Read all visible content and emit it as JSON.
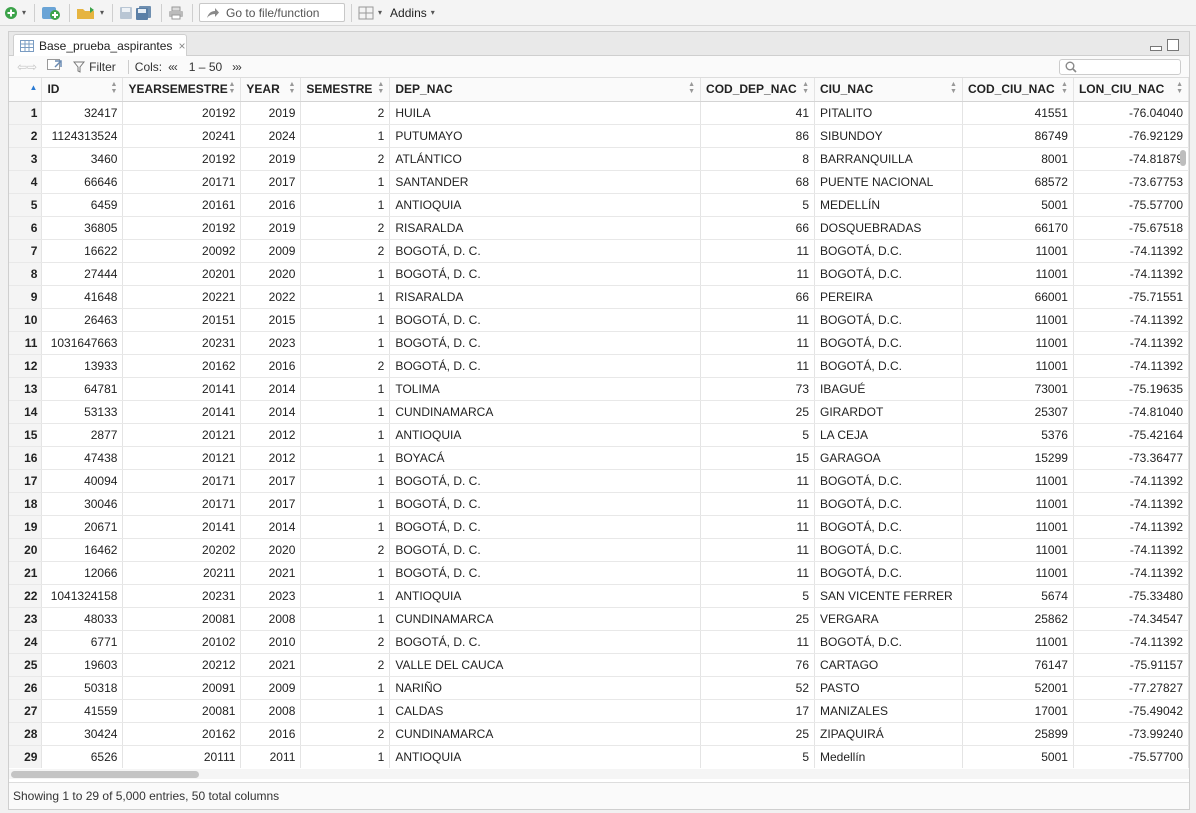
{
  "toolbar": {
    "goto_placeholder": "Go to file/function",
    "addins_label": "Addins"
  },
  "tab": {
    "title": "Base_prueba_aspirantes",
    "close": "×"
  },
  "viewer": {
    "filter_label": "Filter",
    "cols_label": "Cols:",
    "col_prev": "«‹",
    "col_range": "1 – 50",
    "col_next": "›»"
  },
  "table": {
    "columns": [
      "ID",
      "YEARSEMESTRE",
      "YEAR",
      "SEMESTRE",
      "DEP_NAC",
      "COD_DEP_NAC",
      "CIU_NAC",
      "COD_CIU_NAC",
      "LON_CIU_NAC"
    ],
    "rows": [
      [
        "1",
        "32417",
        "20192",
        "2019",
        "2",
        "HUILA",
        "41",
        "PITALITO",
        "41551",
        "-76.04040"
      ],
      [
        "2",
        "1124313524",
        "20241",
        "2024",
        "1",
        "PUTUMAYO",
        "86",
        "SIBUNDOY",
        "86749",
        "-76.92129"
      ],
      [
        "3",
        "3460",
        "20192",
        "2019",
        "2",
        "ATLÁNTICO",
        "8",
        "BARRANQUILLA",
        "8001",
        "-74.81879"
      ],
      [
        "4",
        "66646",
        "20171",
        "2017",
        "1",
        "SANTANDER",
        "68",
        "PUENTE NACIONAL",
        "68572",
        "-73.67753"
      ],
      [
        "5",
        "6459",
        "20161",
        "2016",
        "1",
        "ANTIOQUIA",
        "5",
        "MEDELLÍN",
        "5001",
        "-75.57700"
      ],
      [
        "6",
        "36805",
        "20192",
        "2019",
        "2",
        "RISARALDA",
        "66",
        "DOSQUEBRADAS",
        "66170",
        "-75.67518"
      ],
      [
        "7",
        "16622",
        "20092",
        "2009",
        "2",
        "BOGOTÁ, D. C.",
        "11",
        "BOGOTÁ, D.C.",
        "11001",
        "-74.11392"
      ],
      [
        "8",
        "27444",
        "20201",
        "2020",
        "1",
        "BOGOTÁ, D. C.",
        "11",
        "BOGOTÁ, D.C.",
        "11001",
        "-74.11392"
      ],
      [
        "9",
        "41648",
        "20221",
        "2022",
        "1",
        "RISARALDA",
        "66",
        "PEREIRA",
        "66001",
        "-75.71551"
      ],
      [
        "10",
        "26463",
        "20151",
        "2015",
        "1",
        "BOGOTÁ, D. C.",
        "11",
        "BOGOTÁ, D.C.",
        "11001",
        "-74.11392"
      ],
      [
        "11",
        "1031647663",
        "20231",
        "2023",
        "1",
        "BOGOTÁ, D. C.",
        "11",
        "BOGOTÁ, D.C.",
        "11001",
        "-74.11392"
      ],
      [
        "12",
        "13933",
        "20162",
        "2016",
        "2",
        "BOGOTÁ, D. C.",
        "11",
        "BOGOTÁ, D.C.",
        "11001",
        "-74.11392"
      ],
      [
        "13",
        "64781",
        "20141",
        "2014",
        "1",
        "TOLIMA",
        "73",
        "IBAGUÉ",
        "73001",
        "-75.19635"
      ],
      [
        "14",
        "53133",
        "20141",
        "2014",
        "1",
        "CUNDINAMARCA",
        "25",
        "GIRARDOT",
        "25307",
        "-74.81040"
      ],
      [
        "15",
        "2877",
        "20121",
        "2012",
        "1",
        "ANTIOQUIA",
        "5",
        "LA CEJA",
        "5376",
        "-75.42164"
      ],
      [
        "16",
        "47438",
        "20121",
        "2012",
        "1",
        "BOYACÁ",
        "15",
        "GARAGOA",
        "15299",
        "-73.36477"
      ],
      [
        "17",
        "40094",
        "20171",
        "2017",
        "1",
        "BOGOTÁ, D. C.",
        "11",
        "BOGOTÁ, D.C.",
        "11001",
        "-74.11392"
      ],
      [
        "18",
        "30046",
        "20171",
        "2017",
        "1",
        "BOGOTÁ, D. C.",
        "11",
        "BOGOTÁ, D.C.",
        "11001",
        "-74.11392"
      ],
      [
        "19",
        "20671",
        "20141",
        "2014",
        "1",
        "BOGOTÁ, D. C.",
        "11",
        "BOGOTÁ, D.C.",
        "11001",
        "-74.11392"
      ],
      [
        "20",
        "16462",
        "20202",
        "2020",
        "2",
        "BOGOTÁ, D. C.",
        "11",
        "BOGOTÁ, D.C.",
        "11001",
        "-74.11392"
      ],
      [
        "21",
        "12066",
        "20211",
        "2021",
        "1",
        "BOGOTÁ, D. C.",
        "11",
        "BOGOTÁ, D.C.",
        "11001",
        "-74.11392"
      ],
      [
        "22",
        "1041324158",
        "20231",
        "2023",
        "1",
        "ANTIOQUIA",
        "5",
        "SAN VICENTE FERRER",
        "5674",
        "-75.33480"
      ],
      [
        "23",
        "48033",
        "20081",
        "2008",
        "1",
        "CUNDINAMARCA",
        "25",
        "VERGARA",
        "25862",
        "-74.34547"
      ],
      [
        "24",
        "6771",
        "20102",
        "2010",
        "2",
        "BOGOTÁ, D. C.",
        "11",
        "BOGOTÁ, D.C.",
        "11001",
        "-74.11392"
      ],
      [
        "25",
        "19603",
        "20212",
        "2021",
        "2",
        "VALLE DEL CAUCA",
        "76",
        "CARTAGO",
        "76147",
        "-75.91157"
      ],
      [
        "26",
        "50318",
        "20091",
        "2009",
        "1",
        "NARIÑO",
        "52",
        "PASTO",
        "52001",
        "-77.27827"
      ],
      [
        "27",
        "41559",
        "20081",
        "2008",
        "1",
        "CALDAS",
        "17",
        "MANIZALES",
        "17001",
        "-75.49042"
      ],
      [
        "28",
        "30424",
        "20162",
        "2016",
        "2",
        "CUNDINAMARCA",
        "25",
        "ZIPAQUIRÁ",
        "25899",
        "-73.99240"
      ],
      [
        "29",
        "6526",
        "20111",
        "2011",
        "1",
        "ANTIOQUIA",
        "5",
        "Medellín",
        "5001",
        "-75.57700"
      ]
    ]
  },
  "status": {
    "text": "Showing 1 to 29 of 5,000 entries, 50 total columns"
  }
}
